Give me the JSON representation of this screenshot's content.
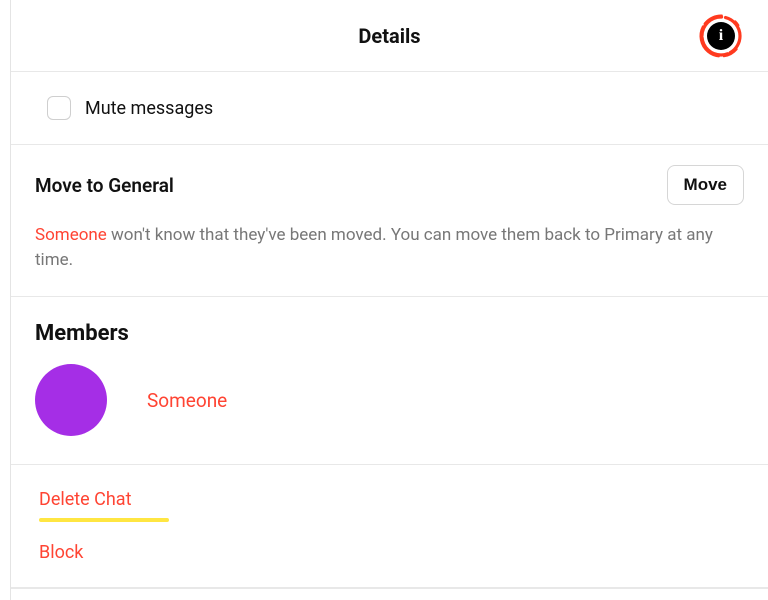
{
  "header": {
    "title": "Details",
    "info_glyph": "i"
  },
  "mute": {
    "label": "Mute messages"
  },
  "move": {
    "title": "Move to General",
    "button": "Move",
    "user": "Someone",
    "desc_rest": " won't know that they've been moved. You can move them back to Primary at any time."
  },
  "members": {
    "title": "Members",
    "items": [
      {
        "name": "Someone",
        "avatar_color": "#a52ee6"
      }
    ]
  },
  "actions": {
    "delete": "Delete Chat",
    "block": "Block"
  }
}
